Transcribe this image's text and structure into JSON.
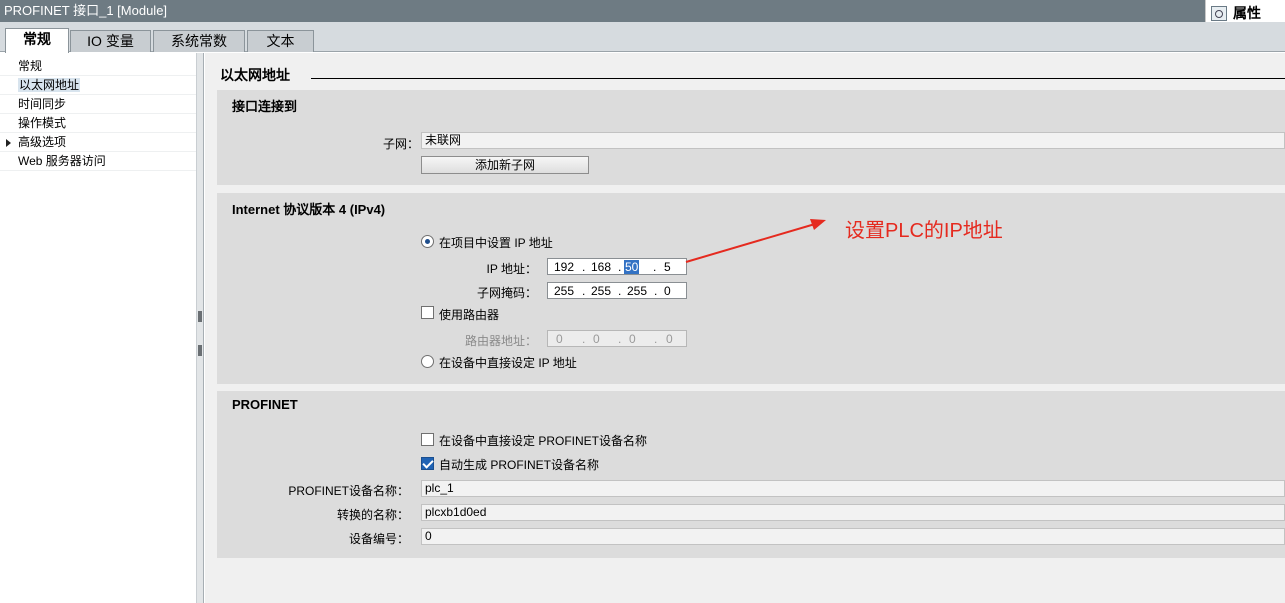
{
  "window": {
    "title": "PROFINET 接口_1 [Module]",
    "properties_label": "属性"
  },
  "tabs": [
    {
      "label": "常规",
      "active": true
    },
    {
      "label": "IO 变量",
      "active": false
    },
    {
      "label": "系统常数",
      "active": false
    },
    {
      "label": "文本",
      "active": false
    }
  ],
  "nav": [
    {
      "label": "常规",
      "selected": false
    },
    {
      "label": "以太网地址",
      "selected": true
    },
    {
      "label": "时间同步",
      "selected": false
    },
    {
      "label": "操作模式",
      "selected": false
    },
    {
      "label": "高级选项",
      "selected": false,
      "expandable": true
    },
    {
      "label": "Web 服务器访问",
      "selected": false
    }
  ],
  "main": {
    "heading": "以太网地址",
    "interface": {
      "title": "接口连接到",
      "subnet_label": "子网：",
      "subnet_value": "未联网",
      "add_subnet_button": "添加新子网"
    },
    "ipv4": {
      "title": "Internet 协议版本 4 (IPv4)",
      "radio_project": "在项目中设置 IP 地址",
      "ip_label": "IP 地址：",
      "ip": [
        "192",
        "168",
        "50",
        "5"
      ],
      "mask_label": "子网掩码：",
      "mask": [
        "255",
        "255",
        "255",
        "0"
      ],
      "use_router": "使用路由器",
      "router_label": "路由器地址：",
      "router": [
        "0",
        "0",
        "0",
        "0"
      ],
      "radio_device": "在设备中直接设定 IP 地址"
    },
    "profinet": {
      "title": "PROFINET",
      "chk_device_name": "在设备中直接设定 PROFINET设备名称",
      "chk_auto": "自动生成 PROFINET设备名称",
      "device_name_label": "PROFINET设备名称：",
      "device_name": "plc_1",
      "converted_label": "转换的名称：",
      "converted": "plcxb1d0ed",
      "number_label": "设备编号：",
      "number": "0"
    }
  },
  "annotation": {
    "text": "设置PLC的IP地址",
    "color": "#e52a1f"
  }
}
